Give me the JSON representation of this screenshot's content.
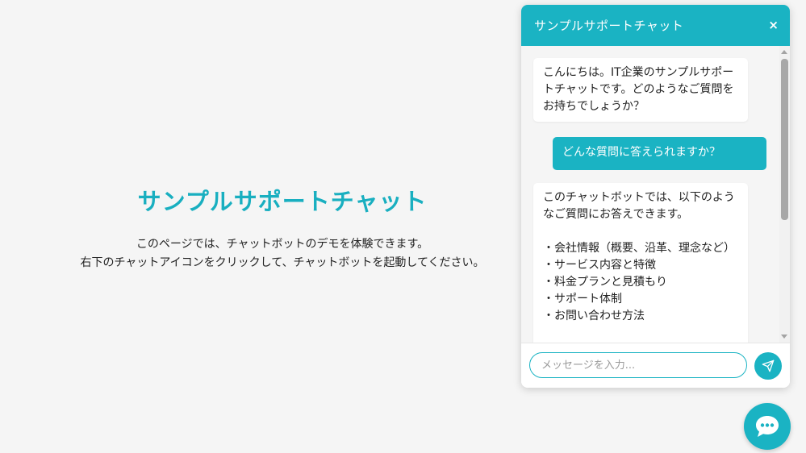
{
  "landing": {
    "title": "サンプルサポートチャット",
    "description_lines": [
      "このページでは、チャットボットのデモを体験できます。",
      "右下のチャットアイコンをクリックして、チャットボットを起動してください。"
    ]
  },
  "chat": {
    "header_title": "サンプルサポートチャット",
    "close_label": "×",
    "messages": [
      {
        "role": "bot",
        "text": "こんにちは。IT企業のサンプルサポートチャットです。どのようなご質問をお持ちでしょうか？"
      },
      {
        "role": "user",
        "text": "どんな質問に答えられますか？"
      },
      {
        "role": "bot",
        "text": "このチャットボットでは、以下のようなご質問にお答えできます。\n\n・会社情報（概要、沿革、理念など）\n・サービス内容と特徴\n・料金プランと見積もり\n・サポート体制\n・お問い合わせ方法"
      }
    ],
    "input": {
      "placeholder": "メッセージを入力...",
      "value": ""
    },
    "send_icon": "send-icon",
    "launcher_icon": "chat-bubble-icon"
  },
  "colors": {
    "accent": "#1ab3c3",
    "title": "#19afc0",
    "background": "#f5f5f5"
  }
}
